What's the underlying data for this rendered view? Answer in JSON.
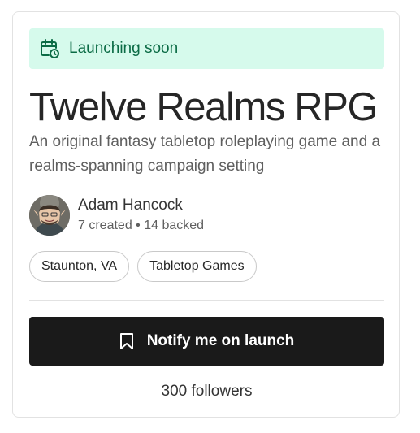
{
  "banner": {
    "icon": "calendar-clock-icon",
    "text": "Launching soon",
    "bg_color": "#d6faec",
    "text_color": "#0b6b45"
  },
  "project": {
    "title": "Twelve Realms RPG",
    "description": "An original fantasy tabletop roleplaying game and a realms-spanning campaign setting"
  },
  "creator": {
    "name": "Adam Hancock",
    "stats": "7 created • 14 backed",
    "avatar": "creator-avatar"
  },
  "tags": [
    {
      "label": "Staunton, VA"
    },
    {
      "label": "Tabletop Games"
    }
  ],
  "action": {
    "icon": "bookmark-icon",
    "label": "Notify me on launch"
  },
  "followers": "300 followers"
}
